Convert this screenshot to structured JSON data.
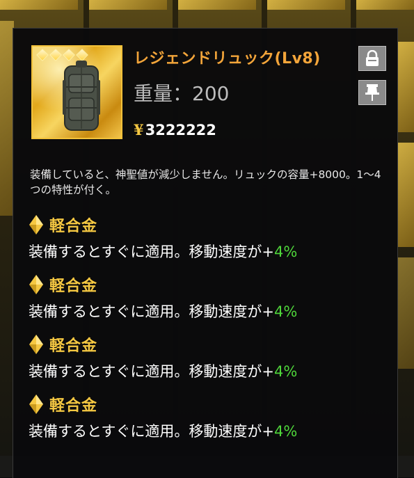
{
  "item": {
    "name": "レジェンドリュック(Lv8)",
    "weight_label": "重量：",
    "weight_value": "200",
    "price_symbol": "¥",
    "price": "3222222",
    "grade_stars": 4,
    "icon": "backpack-icon"
  },
  "actions": {
    "lock_icon": "lock-icon",
    "pin_icon": "pin-icon"
  },
  "description": "装備していると、神聖値が減少しません。リュックの容量+8000。1～4つの特性が付く。",
  "traits": [
    {
      "name": "軽合金",
      "effect_text": "装備するとすぐに適用。移動速度が+",
      "effect_value": "4%"
    },
    {
      "name": "軽合金",
      "effect_text": "装備するとすぐに適用。移動速度が+",
      "effect_value": "4%"
    },
    {
      "name": "軽合金",
      "effect_text": "装備するとすぐに適用。移動速度が+",
      "effect_value": "4%"
    },
    {
      "name": "軽合金",
      "effect_text": "装備するとすぐに適用。移動速度が+",
      "effect_value": "4%"
    }
  ],
  "colors": {
    "name": "#f3a53a",
    "trait_name": "#f5c842",
    "bonus": "#4ed43a",
    "panel_bg": "#0a0a0c"
  }
}
